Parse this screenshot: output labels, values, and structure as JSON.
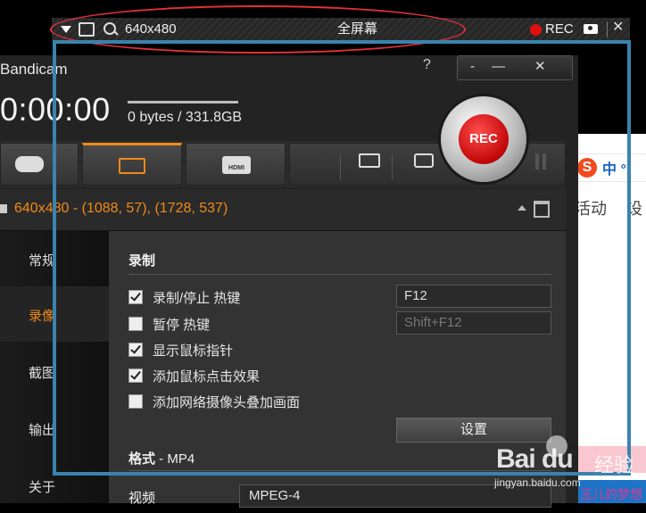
{
  "capture_bar": {
    "size": "640x480",
    "mode": "全屏幕",
    "rec_label": "REC"
  },
  "background_page": {
    "sogou_label": "中 °,",
    "tabs": [
      "活动",
      "设"
    ],
    "bottom_text": "玉儿的梦想"
  },
  "window": {
    "title": "Bandicam",
    "help": "?",
    "min_label": "-",
    "restore_label": "—",
    "close_label": "✕"
  },
  "status": {
    "timer": "0:00:00",
    "size_text": "0 bytes / 331.8GB"
  },
  "rec_button": {
    "label": "REC"
  },
  "tabs": [
    {
      "name": "game-tab",
      "icon": "gamepad-icon"
    },
    {
      "name": "screen-tab",
      "icon": "screen-rect-icon",
      "active": true
    },
    {
      "name": "hdmi-tab",
      "icon": "hdmi-icon",
      "icon_text": "HDMI"
    }
  ],
  "toolbar_icons": [
    "folder-icon",
    "camera-icon",
    "pause-icon"
  ],
  "info": {
    "coords": "640x480 - (1088, 57), (1728, 537)"
  },
  "sidebar": {
    "items": [
      {
        "label": "常规",
        "active": false
      },
      {
        "label": "录像",
        "active": true
      },
      {
        "label": "截图",
        "active": false
      },
      {
        "label": "输出",
        "active": false
      },
      {
        "label": "关于",
        "active": false
      }
    ]
  },
  "record": {
    "section_title": "录制",
    "options": [
      {
        "label": "录制/停止 热键",
        "checked": true
      },
      {
        "label": "暂停 热键",
        "checked": false
      },
      {
        "label": "显示鼠标指针",
        "checked": true
      },
      {
        "label": "添加鼠标点击效果",
        "checked": true
      },
      {
        "label": "添加网络摄像头叠加画面",
        "checked": false
      }
    ],
    "hotkey_record": "F12",
    "hotkey_pause": "Shift+F12",
    "settings_button": "设置"
  },
  "format": {
    "title": "格式",
    "value": " - MP4",
    "video_label": "视频",
    "video_codec": "MPEG-4"
  },
  "watermark": {
    "brand": "Bai du",
    "jingyan": "经验",
    "url": "jingyan.baidu.com"
  },
  "colors": {
    "accent_orange": "#f08a18",
    "rec_red": "#e01010",
    "annotation_red": "#e0303a",
    "selection_blue": "#3a83ae"
  }
}
